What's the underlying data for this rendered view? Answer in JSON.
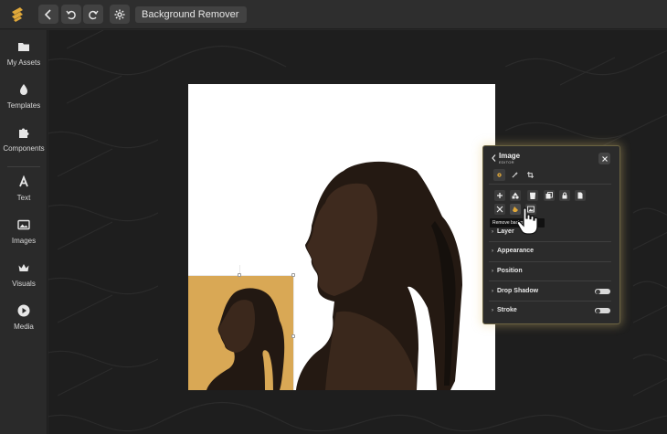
{
  "toolbar": {
    "title": "Background Remover",
    "back_icon": "chevron-left-icon",
    "undo_icon": "undo-icon",
    "redo_icon": "redo-icon",
    "settings_icon": "gear-icon",
    "accent": "#e0a83a"
  },
  "sidebar": {
    "items": [
      {
        "label": "My Assets",
        "icon": "folder-icon"
      },
      {
        "label": "Templates",
        "icon": "drop-icon"
      },
      {
        "label": "Components",
        "icon": "puzzle-icon"
      },
      {
        "label": "Text",
        "icon": "text-icon"
      },
      {
        "label": "Images",
        "icon": "image-icon"
      },
      {
        "label": "Visuals",
        "icon": "crown-icon"
      },
      {
        "label": "Media",
        "icon": "play-icon"
      }
    ]
  },
  "panel": {
    "title": "Image",
    "subtitle": "EDITOR",
    "tooltip": "Remove background",
    "sections": [
      {
        "label": "Layer",
        "toggle": false
      },
      {
        "label": "Appearance",
        "toggle": false
      },
      {
        "label": "Position",
        "toggle": false
      },
      {
        "label": "Drop Shadow",
        "toggle": true
      },
      {
        "label": "Stroke",
        "toggle": true
      }
    ]
  }
}
